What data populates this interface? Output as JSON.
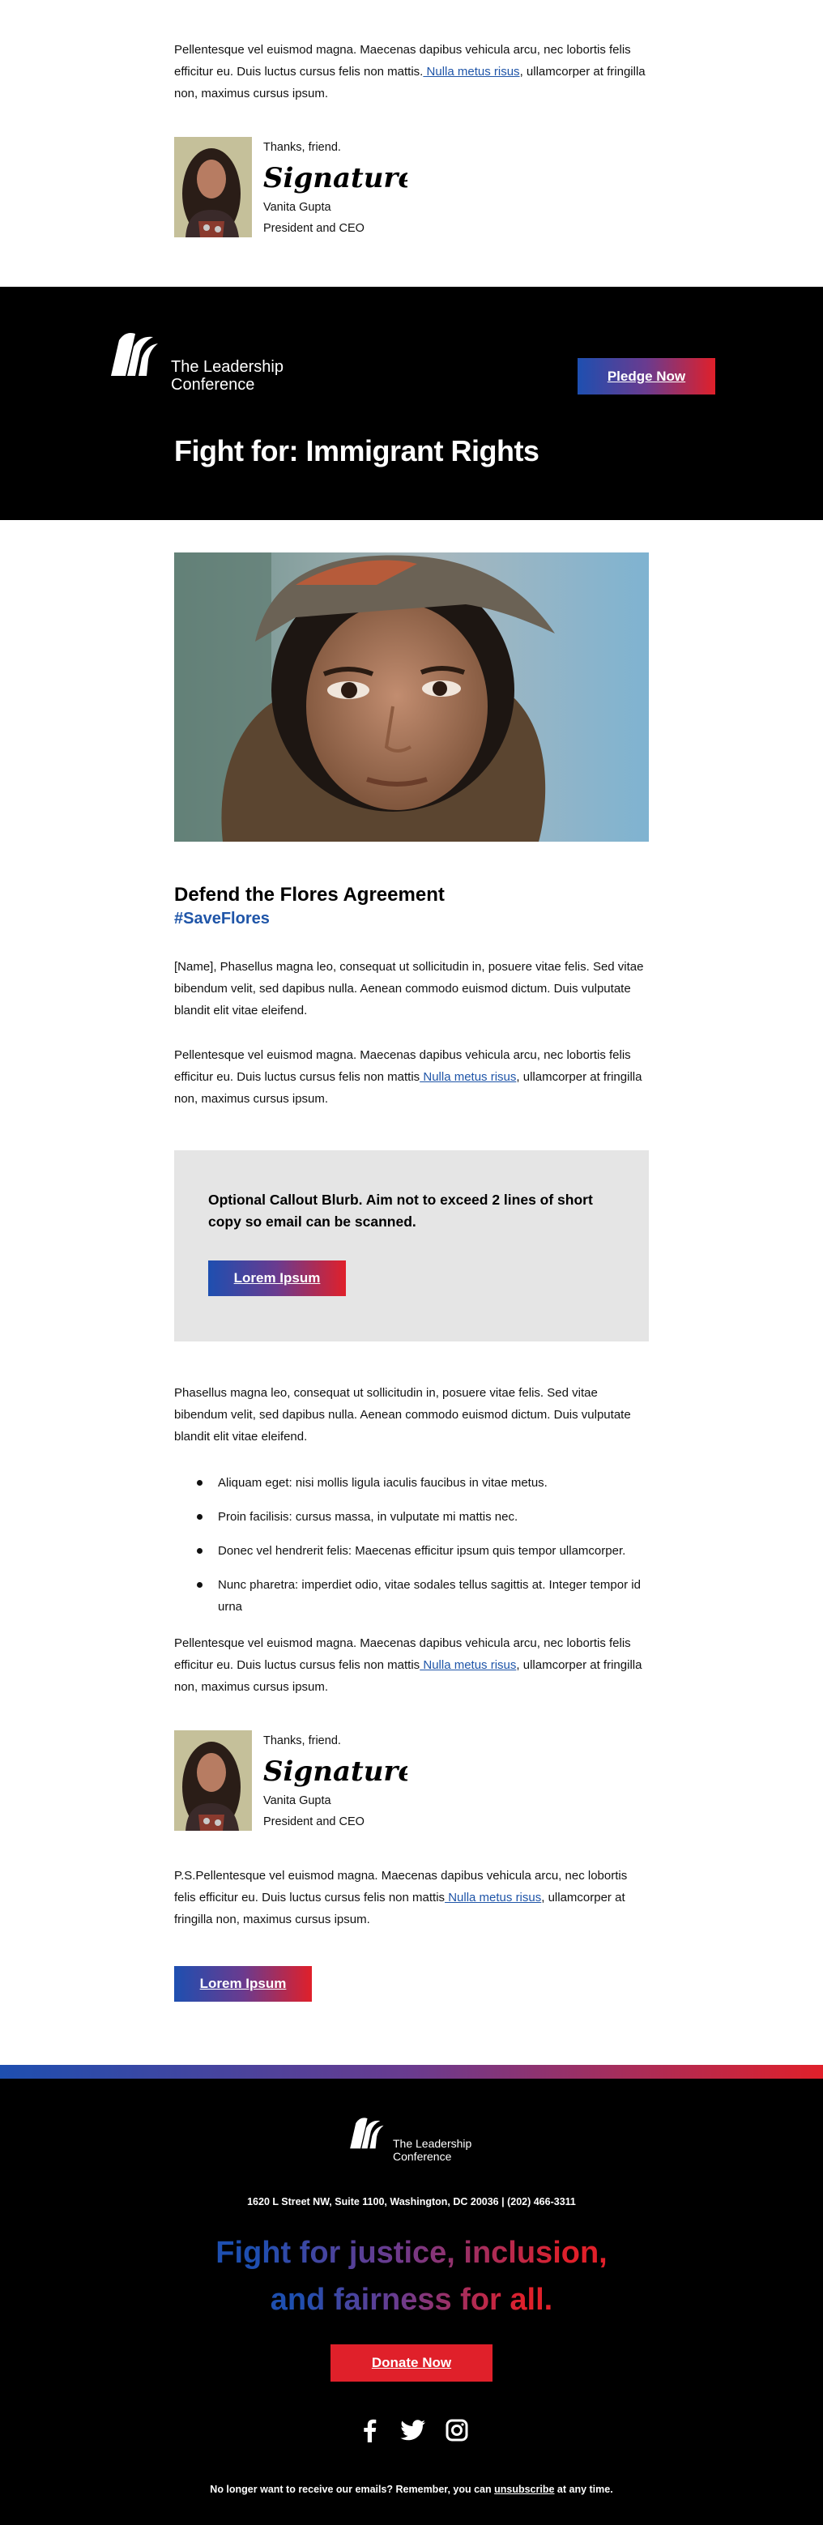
{
  "top": {
    "para": {
      "before": "Pellentesque vel euismod magna. Maecenas dapibus vehicula arcu, nec lobortis felis efficitur eu. Duis luctus cursus felis non mattis.",
      "link": " Nulla metus risus",
      "after": ", ullamcorper at fringilla non, maximus cursus ipsum."
    },
    "signature": {
      "thanks": "Thanks, friend.",
      "sig_text": "Signature",
      "name": "Vanita Gupta",
      "role": "President and CEO"
    }
  },
  "header": {
    "logo_line1": "The Leadership",
    "logo_line2": "Conference",
    "pledge_label": "Pledge Now",
    "title": "Fight for: Immigrant Rights"
  },
  "main": {
    "title": "Defend the Flores Agreement",
    "hashtag": "#SaveFlores",
    "para1": "[Name], Phasellus magna leo, consequat ut sollicitudin in, posuere vitae felis. Sed vitae bibendum velit, sed dapibus nulla. Aenean commodo euismod dictum. Duis vulputate blandit elit vitae eleifend.",
    "para2": {
      "before": "Pellentesque vel euismod magna. Maecenas dapibus vehicula arcu, nec lobortis felis efficitur eu. Duis luctus cursus felis non mattis",
      "link": " Nulla metus risus",
      "after": ", ullamcorper at fringilla non, maximus cursus ipsum."
    },
    "callout": {
      "text": "Optional Callout Blurb. Aim not to exceed 2 lines of short copy so email can be scanned.",
      "button": "Lorem Ipsum"
    },
    "para3": "Phasellus magna leo, consequat ut sollicitudin in, posuere vitae felis. Sed vitae bibendum velit, sed dapibus nulla. Aenean commodo euismod dictum. Duis vulputate blandit elit vitae eleifend.",
    "bullets": [
      "Aliquam eget: nisi mollis ligula iaculis faucibus in vitae metus.",
      "Proin facilisis: cursus massa, in vulputate mi mattis nec.",
      "Donec vel hendrerit felis: Maecenas efficitur ipsum quis tempor ullamcorper.",
      "Nunc pharetra: imperdiet odio, vitae sodales tellus sagittis at. Integer tempor id urna"
    ],
    "para4": {
      "before": "Pellentesque vel euismod magna. Maecenas dapibus vehicula arcu, nec lobortis felis efficitur eu. Duis luctus cursus felis non mattis",
      "link": " Nulla metus risus",
      "after": ", ullamcorper at fringilla non, maximus cursus ipsum."
    },
    "signature": {
      "thanks": "Thanks, friend.",
      "sig_text": "Signature",
      "name": "Vanita Gupta",
      "role": "President and CEO"
    },
    "ps": {
      "before": "P.S.Pellentesque vel euismod magna. Maecenas dapibus vehicula arcu, nec lobortis felis efficitur eu. Duis luctus cursus felis non mattis",
      "link": " Nulla metus risus",
      "after": ", ullamcorper at fringilla non, maximus cursus ipsum."
    },
    "bottom_button": "Lorem Ipsum"
  },
  "footer": {
    "logo_line1": "The Leadership",
    "logo_line2": "Conference",
    "address": "1620 L Street NW, Suite 1100, Washington, DC 20036 | (202) 466-3311",
    "tagline_line1": "Fight for justice, inclusion,",
    "tagline_line2": "and fairness for all.",
    "donate_label": "Donate Now",
    "social": [
      "facebook-icon",
      "twitter-icon",
      "instagram-icon"
    ],
    "unsub_before": "No longer want to receive our emails? Remember, you can ",
    "unsub_link": "unsubscribe",
    "unsub_after": " at any time."
  },
  "colors": {
    "brand_blue": "#1e4fb0",
    "brand_red": "#e0202a",
    "link": "#1f55a8",
    "callout_bg": "#e5e5e5"
  }
}
